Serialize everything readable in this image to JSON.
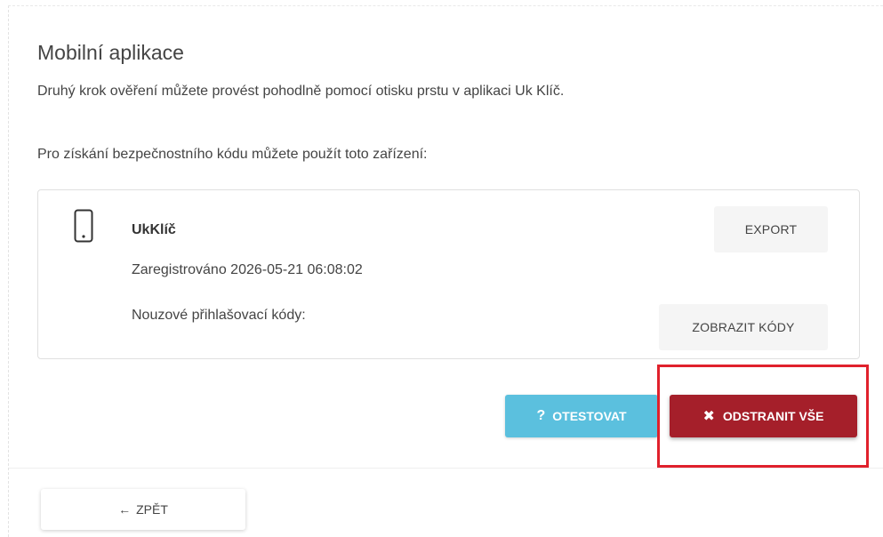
{
  "section": {
    "title": "Mobilní aplikace",
    "description": "Druhý krok ověření můžete provést pohodlně pomocí otisku prstu v aplikaci Uk Klíč.",
    "instruction": "Pro získání bezpečnostního kódu můžete použít toto zařízení:"
  },
  "device": {
    "icon": "smartphone-icon",
    "name": "UkKlíč",
    "registered": "Zaregistrováno 2026-05-21 06:08:02",
    "emergency_codes_label": "Nouzové přihlašovací kódy:",
    "export_label": "EXPORT",
    "show_codes_label": "ZOBRAZIT KÓDY"
  },
  "actions": {
    "test_label": "OTESTOVAT",
    "test_icon": "?",
    "remove_all_label": "ODSTRANIT VŠE",
    "remove_all_icon": "✖",
    "test_color": "#5bc0de",
    "remove_color": "#a51f2a",
    "highlight_color": "#e0212c"
  },
  "navigation": {
    "back_label": "ZPĚT",
    "back_icon": "←"
  }
}
